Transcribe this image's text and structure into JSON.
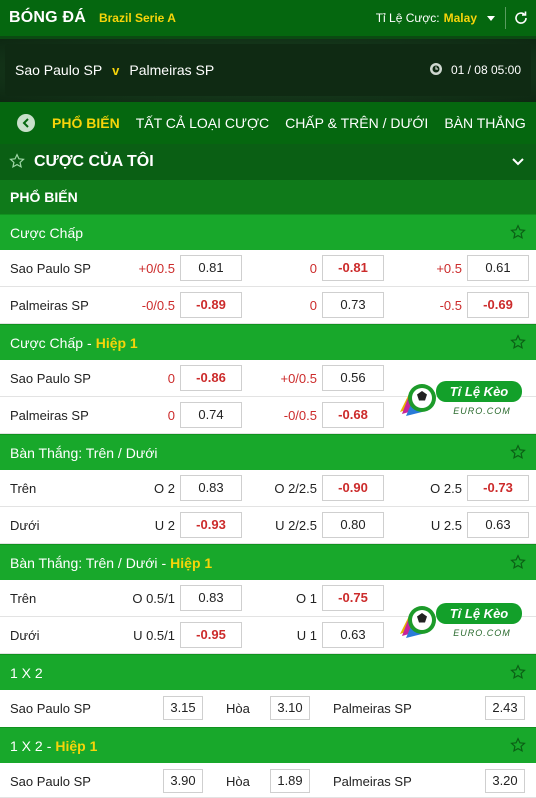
{
  "header": {
    "sport": "BÓNG ĐÁ",
    "league": "Brazil Serie A",
    "odds_type_label": "Tỉ Lệ Cược:",
    "odds_type_value": "Malay"
  },
  "match": {
    "home": "Sao Paulo SP",
    "vs": "v",
    "away": "Palmeiras SP",
    "datetime": "01 / 08  05:00"
  },
  "tabs": [
    "PHỔ BIẾN",
    "TẤT CẢ LOẠI CƯỢC",
    "CHẤP & TRÊN / DƯỚI",
    "BÀN THẮNG"
  ],
  "my_bets": {
    "title": "CƯỢC CỦA TÔI"
  },
  "popular_label": "PHỔ BIẾN",
  "sections": {
    "handicap": {
      "title": "Cược Chấp",
      "rows": [
        {
          "team": "Sao Paulo SP",
          "c1_line": "+0/0.5",
          "c1_odd": "0.81",
          "c2_line": "0",
          "c2_odd": "-0.81",
          "c3_line": "+0.5",
          "c3_odd": "0.61"
        },
        {
          "team": "Palmeiras SP",
          "c1_line": "-0/0.5",
          "c1_odd": "-0.89",
          "c2_line": "0",
          "c2_odd": "0.73",
          "c3_line": "-0.5",
          "c3_odd": "-0.69"
        }
      ]
    },
    "handicap_h1": {
      "title": "Cược Chấp",
      "suffix": "Hiệp 1",
      "rows": [
        {
          "team": "Sao Paulo SP",
          "c1_line": "0",
          "c1_odd": "-0.86",
          "c2_line": "+0/0.5",
          "c2_odd": "0.56"
        },
        {
          "team": "Palmeiras SP",
          "c1_line": "0",
          "c1_odd": "0.74",
          "c2_line": "-0/0.5",
          "c2_odd": "-0.68"
        }
      ]
    },
    "ou": {
      "title": "Bàn Thắng: Trên / Dưới",
      "rows": [
        {
          "team": "Trên",
          "c1_side": "O",
          "c1_line": "2",
          "c1_odd": "0.83",
          "c2_side": "O",
          "c2_line": "2/2.5",
          "c2_odd": "-0.90",
          "c3_side": "O",
          "c3_line": "2.5",
          "c3_odd": "-0.73"
        },
        {
          "team": "Dưới",
          "c1_side": "U",
          "c1_line": "2",
          "c1_odd": "-0.93",
          "c2_side": "U",
          "c2_line": "2/2.5",
          "c2_odd": "0.80",
          "c3_side": "U",
          "c3_line": "2.5",
          "c3_odd": "0.63"
        }
      ]
    },
    "ou_h1": {
      "title": "Bàn Thắng: Trên / Dưới",
      "suffix": "Hiệp 1",
      "rows": [
        {
          "team": "Trên",
          "c1_side": "O",
          "c1_line": "0.5/1",
          "c1_odd": "0.83",
          "c2_side": "O",
          "c2_line": "1",
          "c2_odd": "-0.75"
        },
        {
          "team": "Dưới",
          "c1_side": "U",
          "c1_line": "0.5/1",
          "c1_odd": "-0.95",
          "c2_side": "U",
          "c2_line": "1",
          "c2_odd": "0.63"
        }
      ]
    },
    "x12": {
      "title": "1 X 2",
      "home": "Sao Paulo SP",
      "home_odd": "3.15",
      "draw": "Hòa",
      "draw_odd": "3.10",
      "away": "Palmeiras SP",
      "away_odd": "2.43"
    },
    "x12_h1": {
      "title": "1 X 2",
      "suffix": "Hiệp 1",
      "home": "Sao Paulo SP",
      "home_odd": "3.90",
      "draw": "Hòa",
      "draw_odd": "1.89",
      "away": "Palmeiras SP",
      "away_odd": "3.20"
    }
  },
  "watermark": {
    "line1": "Tỉ Lệ Kèo",
    "line2": "EURO.COM"
  }
}
